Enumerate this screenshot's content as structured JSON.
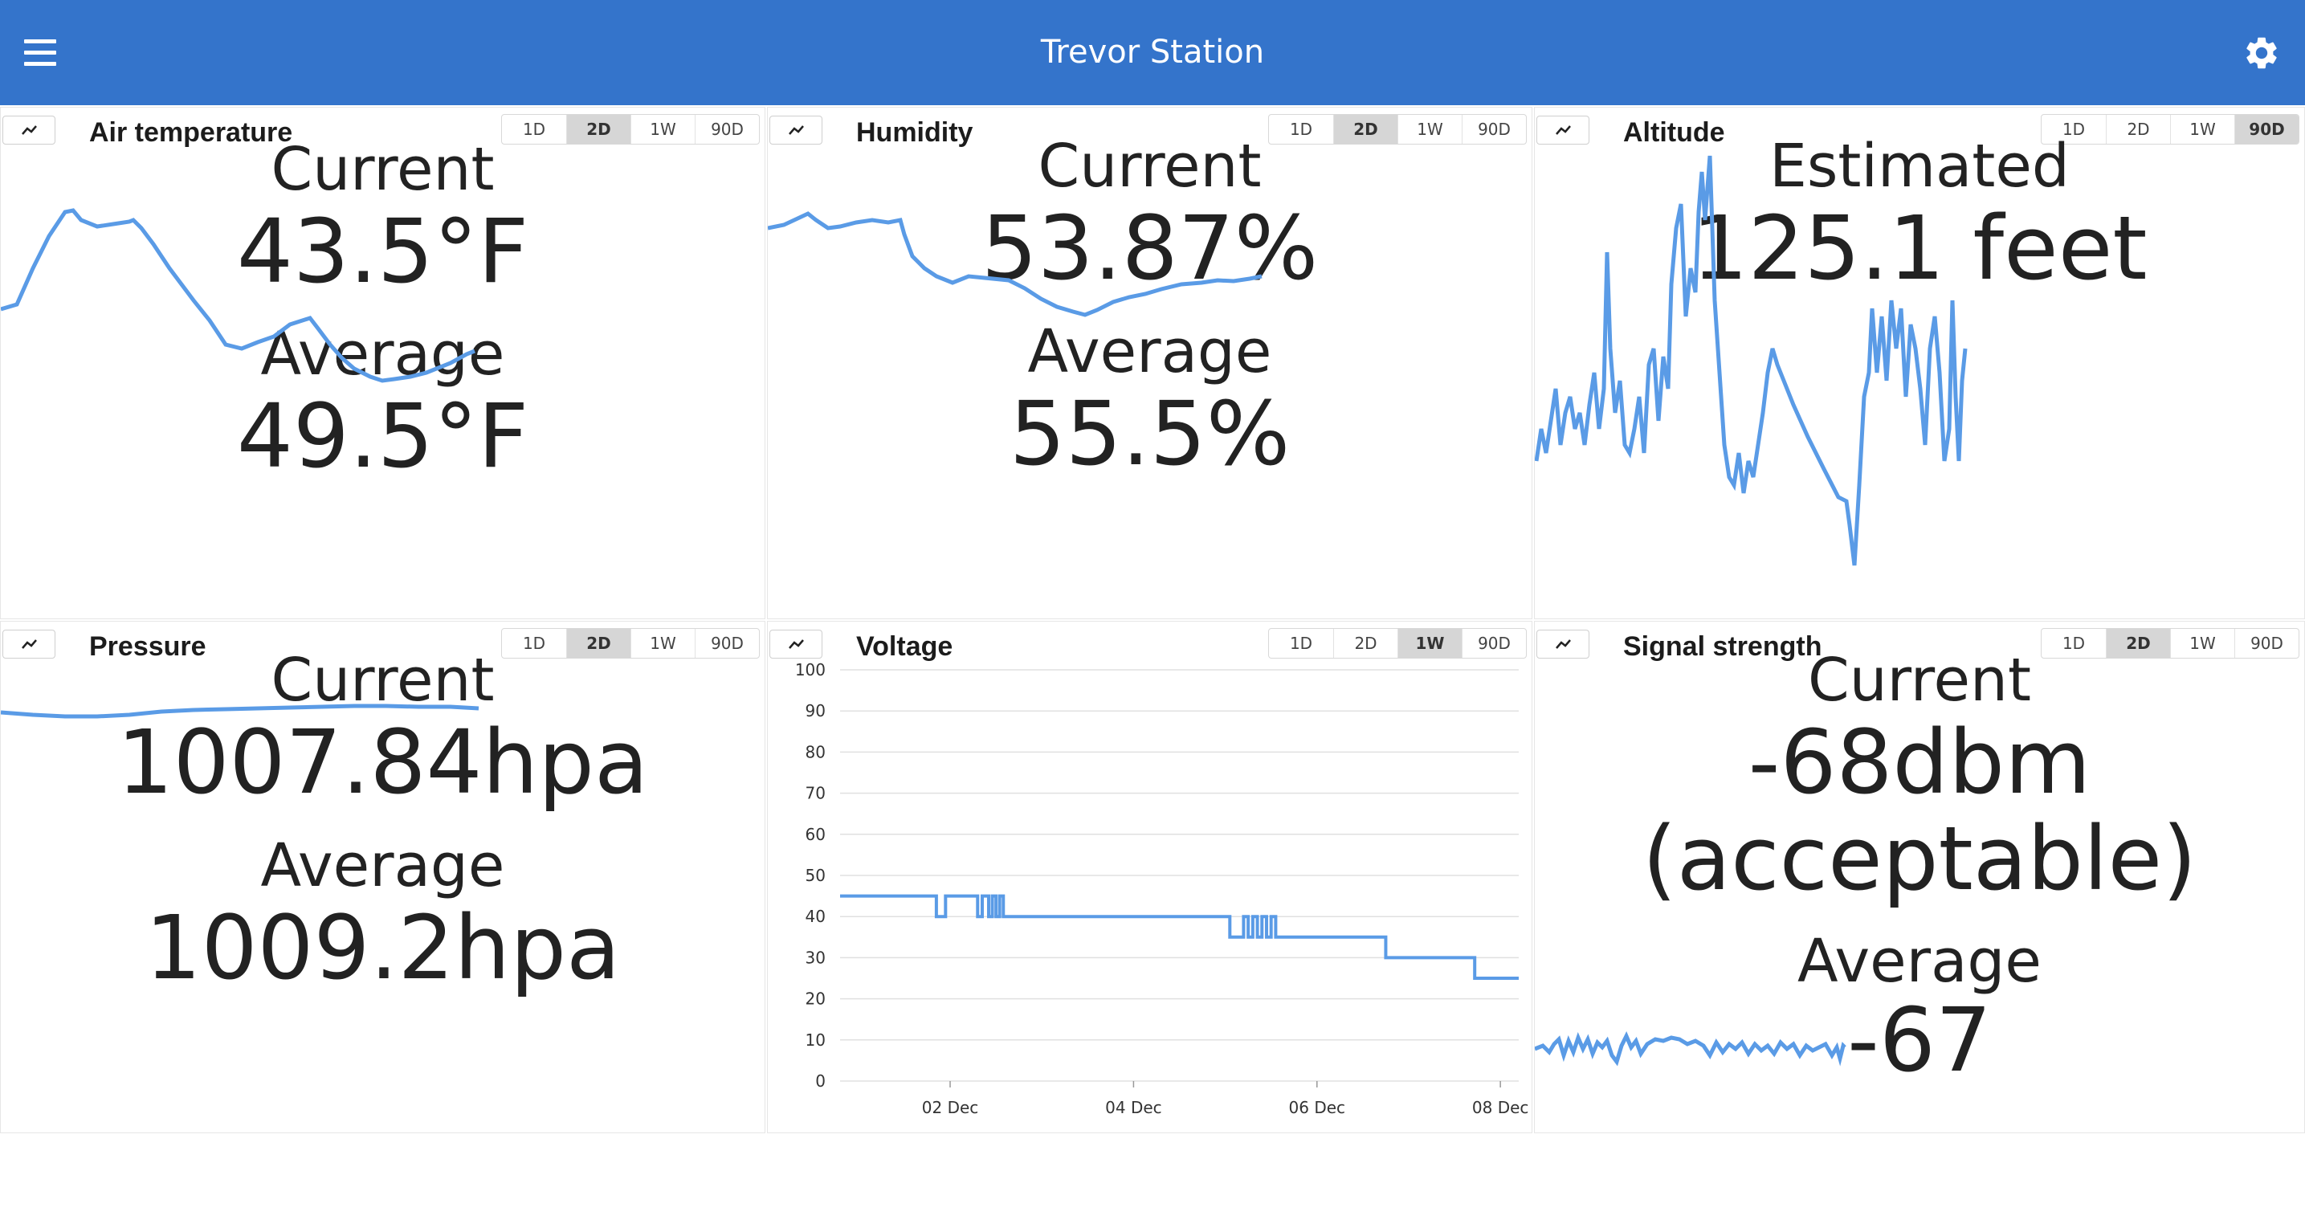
{
  "app": {
    "title": "Trevor Station"
  },
  "icons": {
    "menu": "menu-icon",
    "settings": "gear-icon",
    "chart_toggle": "trend-line-icon"
  },
  "colors": {
    "appbar": "#3474cb",
    "line": "#5a9be6",
    "active_range": "#d6d6d6"
  },
  "range_options": [
    "1D",
    "2D",
    "1W",
    "90D"
  ],
  "cards": [
    {
      "title": "Air temperature",
      "active_range": "2D",
      "stat1_label": "Current",
      "stat1_value": "43.5°F",
      "stat2_label": "Average",
      "stat2_value": "49.5°F"
    },
    {
      "title": "Humidity",
      "active_range": "2D",
      "stat1_label": "Current",
      "stat1_value": "53.87%",
      "stat2_label": "Average",
      "stat2_value": "55.5%"
    },
    {
      "title": "Altitude",
      "active_range": "90D",
      "stat1_label": "Estimated",
      "stat1_value": "125.1 feet"
    },
    {
      "title": "Pressure",
      "active_range": "2D",
      "stat1_label": "Current",
      "stat1_value": "1007.84hpa",
      "stat2_label": "Average",
      "stat2_value": "1009.2hpa"
    },
    {
      "title": "Voltage",
      "active_range": "1W"
    },
    {
      "title": "Signal strength",
      "active_range": "2D",
      "stat1_label": "Current",
      "stat1_value": "-68dbm",
      "stat1_value_line2": "(acceptable)",
      "stat2_label": "Average",
      "stat2_value": "-67"
    }
  ],
  "chart_data": {
    "type": "line",
    "y_ticks": [
      "0",
      "10",
      "20",
      "30",
      "40",
      "50",
      "60",
      "70",
      "80",
      "90",
      "100"
    ],
    "ylim": [
      0,
      100
    ],
    "x_ticks": [
      "02 Dec",
      "04 Dec",
      "06 Dec",
      "08 Dec"
    ],
    "grid": true,
    "series": [
      {
        "values": [
          [
            1.0,
            45
          ],
          [
            2.05,
            45
          ],
          [
            2.05,
            40
          ],
          [
            2.15,
            40
          ],
          [
            2.15,
            45
          ],
          [
            2.5,
            45
          ],
          [
            2.5,
            40
          ],
          [
            2.55,
            40
          ],
          [
            2.55,
            45
          ],
          [
            2.62,
            45
          ],
          [
            2.62,
            40
          ],
          [
            2.66,
            40
          ],
          [
            2.66,
            45
          ],
          [
            2.7,
            45
          ],
          [
            2.7,
            40
          ],
          [
            2.74,
            40
          ],
          [
            2.74,
            45
          ],
          [
            2.78,
            45
          ],
          [
            2.78,
            40
          ],
          [
            5.25,
            40
          ],
          [
            5.25,
            35
          ],
          [
            5.4,
            35
          ],
          [
            5.4,
            40
          ],
          [
            5.45,
            40
          ],
          [
            5.45,
            35
          ],
          [
            5.5,
            35
          ],
          [
            5.5,
            40
          ],
          [
            5.55,
            40
          ],
          [
            5.55,
            35
          ],
          [
            5.6,
            35
          ],
          [
            5.6,
            40
          ],
          [
            5.65,
            40
          ],
          [
            5.65,
            35
          ],
          [
            5.7,
            35
          ],
          [
            5.7,
            40
          ],
          [
            5.75,
            40
          ],
          [
            5.75,
            35
          ],
          [
            6.95,
            35
          ],
          [
            6.95,
            30
          ],
          [
            7.92,
            30
          ],
          [
            7.92,
            25
          ],
          [
            8.4,
            25
          ]
        ]
      }
    ]
  }
}
